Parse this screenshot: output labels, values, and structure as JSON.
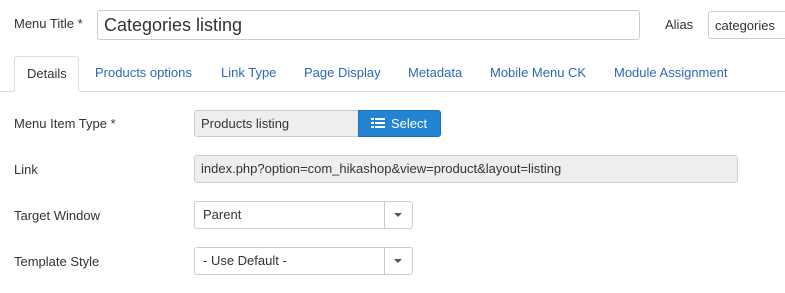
{
  "header": {
    "menu_title_label": "Menu Title *",
    "menu_title_value": "Categories listing",
    "alias_label": "Alias",
    "alias_value": "categories"
  },
  "tabs": [
    {
      "label": "Details",
      "active": true
    },
    {
      "label": "Products options",
      "active": false
    },
    {
      "label": "Link Type",
      "active": false
    },
    {
      "label": "Page Display",
      "active": false
    },
    {
      "label": "Metadata",
      "active": false
    },
    {
      "label": "Mobile Menu CK",
      "active": false
    },
    {
      "label": "Module Assignment",
      "active": false
    }
  ],
  "details": {
    "menu_item_type_label": "Menu Item Type *",
    "menu_item_type_value": "Products listing",
    "select_button_label": "Select",
    "select_button_icon": "list-icon",
    "link_label": "Link",
    "link_value": "index.php?option=com_hikashop&view=product&layout=listing",
    "target_window_label": "Target Window",
    "target_window_value": "Parent",
    "template_style_label": "Template Style",
    "template_style_value": "- Use Default -"
  },
  "colors": {
    "accent": "#2384d3",
    "tab_link": "#2a69b8",
    "readonly_bg": "#eeeeee",
    "border": "#cccccc"
  }
}
